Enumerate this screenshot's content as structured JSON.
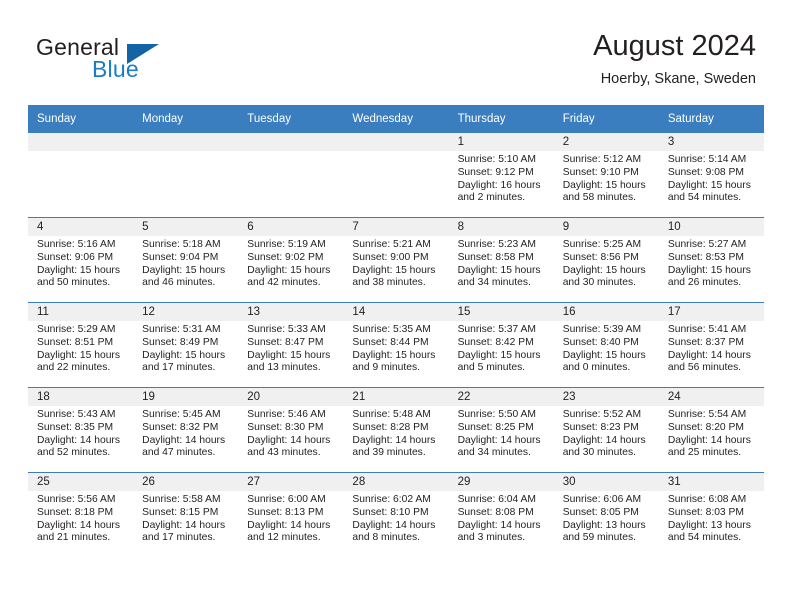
{
  "brand": {
    "name_part1": "General",
    "name_part2": "Blue",
    "flag_icon": "blue-triangle-flag-icon"
  },
  "header": {
    "title": "August 2024",
    "subtitle": "Hoerby, Skane, Sweden"
  },
  "colors": {
    "header_blue": "#3a7ebf",
    "brand_blue": "#1b7dc4",
    "flag_blue": "#1464a5",
    "daynum_band": "#f0f0f0",
    "text": "#231f20"
  },
  "calendar": {
    "weekday_headers": [
      "Sunday",
      "Monday",
      "Tuesday",
      "Wednesday",
      "Thursday",
      "Friday",
      "Saturday"
    ],
    "weeks": [
      [
        {
          "day": "",
          "empty": true,
          "sunrise": "",
          "sunset": "",
          "daylight_line1": "",
          "daylight_line2": ""
        },
        {
          "day": "",
          "empty": true,
          "sunrise": "",
          "sunset": "",
          "daylight_line1": "",
          "daylight_line2": ""
        },
        {
          "day": "",
          "empty": true,
          "sunrise": "",
          "sunset": "",
          "daylight_line1": "",
          "daylight_line2": ""
        },
        {
          "day": "",
          "empty": true,
          "sunrise": "",
          "sunset": "",
          "daylight_line1": "",
          "daylight_line2": ""
        },
        {
          "day": "1",
          "empty": false,
          "sunrise": "Sunrise: 5:10 AM",
          "sunset": "Sunset: 9:12 PM",
          "daylight_line1": "Daylight: 16 hours",
          "daylight_line2": "and 2 minutes."
        },
        {
          "day": "2",
          "empty": false,
          "sunrise": "Sunrise: 5:12 AM",
          "sunset": "Sunset: 9:10 PM",
          "daylight_line1": "Daylight: 15 hours",
          "daylight_line2": "and 58 minutes."
        },
        {
          "day": "3",
          "empty": false,
          "sunrise": "Sunrise: 5:14 AM",
          "sunset": "Sunset: 9:08 PM",
          "daylight_line1": "Daylight: 15 hours",
          "daylight_line2": "and 54 minutes."
        }
      ],
      [
        {
          "day": "4",
          "empty": false,
          "sunrise": "Sunrise: 5:16 AM",
          "sunset": "Sunset: 9:06 PM",
          "daylight_line1": "Daylight: 15 hours",
          "daylight_line2": "and 50 minutes."
        },
        {
          "day": "5",
          "empty": false,
          "sunrise": "Sunrise: 5:18 AM",
          "sunset": "Sunset: 9:04 PM",
          "daylight_line1": "Daylight: 15 hours",
          "daylight_line2": "and 46 minutes."
        },
        {
          "day": "6",
          "empty": false,
          "sunrise": "Sunrise: 5:19 AM",
          "sunset": "Sunset: 9:02 PM",
          "daylight_line1": "Daylight: 15 hours",
          "daylight_line2": "and 42 minutes."
        },
        {
          "day": "7",
          "empty": false,
          "sunrise": "Sunrise: 5:21 AM",
          "sunset": "Sunset: 9:00 PM",
          "daylight_line1": "Daylight: 15 hours",
          "daylight_line2": "and 38 minutes."
        },
        {
          "day": "8",
          "empty": false,
          "sunrise": "Sunrise: 5:23 AM",
          "sunset": "Sunset: 8:58 PM",
          "daylight_line1": "Daylight: 15 hours",
          "daylight_line2": "and 34 minutes."
        },
        {
          "day": "9",
          "empty": false,
          "sunrise": "Sunrise: 5:25 AM",
          "sunset": "Sunset: 8:56 PM",
          "daylight_line1": "Daylight: 15 hours",
          "daylight_line2": "and 30 minutes."
        },
        {
          "day": "10",
          "empty": false,
          "sunrise": "Sunrise: 5:27 AM",
          "sunset": "Sunset: 8:53 PM",
          "daylight_line1": "Daylight: 15 hours",
          "daylight_line2": "and 26 minutes."
        }
      ],
      [
        {
          "day": "11",
          "empty": false,
          "sunrise": "Sunrise: 5:29 AM",
          "sunset": "Sunset: 8:51 PM",
          "daylight_line1": "Daylight: 15 hours",
          "daylight_line2": "and 22 minutes."
        },
        {
          "day": "12",
          "empty": false,
          "sunrise": "Sunrise: 5:31 AM",
          "sunset": "Sunset: 8:49 PM",
          "daylight_line1": "Daylight: 15 hours",
          "daylight_line2": "and 17 minutes."
        },
        {
          "day": "13",
          "empty": false,
          "sunrise": "Sunrise: 5:33 AM",
          "sunset": "Sunset: 8:47 PM",
          "daylight_line1": "Daylight: 15 hours",
          "daylight_line2": "and 13 minutes."
        },
        {
          "day": "14",
          "empty": false,
          "sunrise": "Sunrise: 5:35 AM",
          "sunset": "Sunset: 8:44 PM",
          "daylight_line1": "Daylight: 15 hours",
          "daylight_line2": "and 9 minutes."
        },
        {
          "day": "15",
          "empty": false,
          "sunrise": "Sunrise: 5:37 AM",
          "sunset": "Sunset: 8:42 PM",
          "daylight_line1": "Daylight: 15 hours",
          "daylight_line2": "and 5 minutes."
        },
        {
          "day": "16",
          "empty": false,
          "sunrise": "Sunrise: 5:39 AM",
          "sunset": "Sunset: 8:40 PM",
          "daylight_line1": "Daylight: 15 hours",
          "daylight_line2": "and 0 minutes."
        },
        {
          "day": "17",
          "empty": false,
          "sunrise": "Sunrise: 5:41 AM",
          "sunset": "Sunset: 8:37 PM",
          "daylight_line1": "Daylight: 14 hours",
          "daylight_line2": "and 56 minutes."
        }
      ],
      [
        {
          "day": "18",
          "empty": false,
          "sunrise": "Sunrise: 5:43 AM",
          "sunset": "Sunset: 8:35 PM",
          "daylight_line1": "Daylight: 14 hours",
          "daylight_line2": "and 52 minutes."
        },
        {
          "day": "19",
          "empty": false,
          "sunrise": "Sunrise: 5:45 AM",
          "sunset": "Sunset: 8:32 PM",
          "daylight_line1": "Daylight: 14 hours",
          "daylight_line2": "and 47 minutes."
        },
        {
          "day": "20",
          "empty": false,
          "sunrise": "Sunrise: 5:46 AM",
          "sunset": "Sunset: 8:30 PM",
          "daylight_line1": "Daylight: 14 hours",
          "daylight_line2": "and 43 minutes."
        },
        {
          "day": "21",
          "empty": false,
          "sunrise": "Sunrise: 5:48 AM",
          "sunset": "Sunset: 8:28 PM",
          "daylight_line1": "Daylight: 14 hours",
          "daylight_line2": "and 39 minutes."
        },
        {
          "day": "22",
          "empty": false,
          "sunrise": "Sunrise: 5:50 AM",
          "sunset": "Sunset: 8:25 PM",
          "daylight_line1": "Daylight: 14 hours",
          "daylight_line2": "and 34 minutes."
        },
        {
          "day": "23",
          "empty": false,
          "sunrise": "Sunrise: 5:52 AM",
          "sunset": "Sunset: 8:23 PM",
          "daylight_line1": "Daylight: 14 hours",
          "daylight_line2": "and 30 minutes."
        },
        {
          "day": "24",
          "empty": false,
          "sunrise": "Sunrise: 5:54 AM",
          "sunset": "Sunset: 8:20 PM",
          "daylight_line1": "Daylight: 14 hours",
          "daylight_line2": "and 25 minutes."
        }
      ],
      [
        {
          "day": "25",
          "empty": false,
          "sunrise": "Sunrise: 5:56 AM",
          "sunset": "Sunset: 8:18 PM",
          "daylight_line1": "Daylight: 14 hours",
          "daylight_line2": "and 21 minutes."
        },
        {
          "day": "26",
          "empty": false,
          "sunrise": "Sunrise: 5:58 AM",
          "sunset": "Sunset: 8:15 PM",
          "daylight_line1": "Daylight: 14 hours",
          "daylight_line2": "and 17 minutes."
        },
        {
          "day": "27",
          "empty": false,
          "sunrise": "Sunrise: 6:00 AM",
          "sunset": "Sunset: 8:13 PM",
          "daylight_line1": "Daylight: 14 hours",
          "daylight_line2": "and 12 minutes."
        },
        {
          "day": "28",
          "empty": false,
          "sunrise": "Sunrise: 6:02 AM",
          "sunset": "Sunset: 8:10 PM",
          "daylight_line1": "Daylight: 14 hours",
          "daylight_line2": "and 8 minutes."
        },
        {
          "day": "29",
          "empty": false,
          "sunrise": "Sunrise: 6:04 AM",
          "sunset": "Sunset: 8:08 PM",
          "daylight_line1": "Daylight: 14 hours",
          "daylight_line2": "and 3 minutes."
        },
        {
          "day": "30",
          "empty": false,
          "sunrise": "Sunrise: 6:06 AM",
          "sunset": "Sunset: 8:05 PM",
          "daylight_line1": "Daylight: 13 hours",
          "daylight_line2": "and 59 minutes."
        },
        {
          "day": "31",
          "empty": false,
          "sunrise": "Sunrise: 6:08 AM",
          "sunset": "Sunset: 8:03 PM",
          "daylight_line1": "Daylight: 13 hours",
          "daylight_line2": "and 54 minutes."
        }
      ]
    ]
  }
}
